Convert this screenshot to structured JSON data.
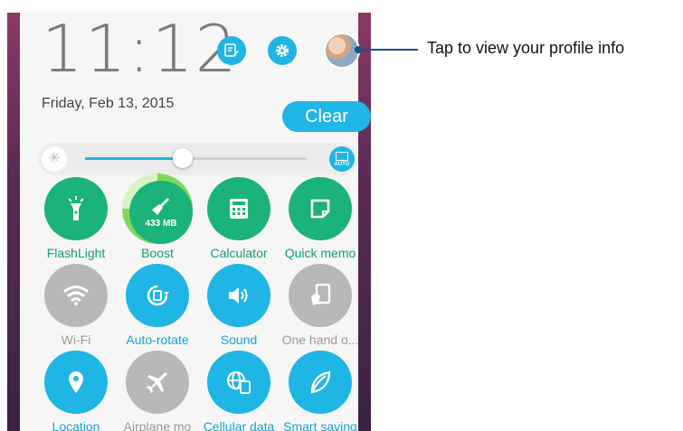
{
  "status": {
    "time": "11:12",
    "date": "Friday, Feb 13, 2015"
  },
  "header": {
    "clear_label": "Clear",
    "edit_icon": "edit-icon",
    "settings_icon": "gear-icon",
    "avatar": "profile-avatar"
  },
  "brightness": {
    "level": 0.44,
    "auto_label": "AUTO"
  },
  "tiles": [
    {
      "label": "FlashLight",
      "state": "on",
      "icon": "flashlight-icon"
    },
    {
      "label": "Boost",
      "state": "on",
      "icon": "broom-icon",
      "value": "433 MB"
    },
    {
      "label": "Calculator",
      "state": "on",
      "icon": "calculator-icon"
    },
    {
      "label": "Quick memo",
      "state": "on",
      "icon": "memo-icon"
    },
    {
      "label": "Wi-Fi",
      "state": "off",
      "icon": "wifi-icon"
    },
    {
      "label": "Auto-rotate",
      "state": "on",
      "icon": "rotate-icon"
    },
    {
      "label": "Sound",
      "state": "on",
      "icon": "speaker-icon"
    },
    {
      "label": "One hand o...",
      "state": "off",
      "icon": "one-hand-icon"
    },
    {
      "label": "Location",
      "state": "on",
      "icon": "location-pin-icon"
    },
    {
      "label": "Airplane mo",
      "state": "off",
      "icon": "airplane-icon"
    },
    {
      "label": "Cellular data",
      "state": "on",
      "icon": "cellular-data-icon"
    },
    {
      "label": "Smart saving",
      "state": "on",
      "icon": "leaf-icon"
    }
  ],
  "callout": {
    "text": "Tap to view your profile info"
  },
  "colors": {
    "accent_blue": "#1fb5e5",
    "accent_green": "#1bb37a",
    "off_grey": "#b8b8b8"
  }
}
